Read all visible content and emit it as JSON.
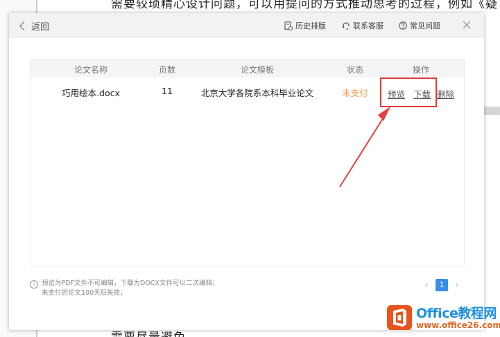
{
  "background": {
    "top_text": "需要较琐精心设计问题，可以用提问的方式推动思考的过程，例如《疑",
    "bottom_text": "需要尽量避免"
  },
  "dialog": {
    "back_label": "返回",
    "header_links": [
      {
        "label": "历史排版",
        "icon": "history-doc-icon"
      },
      {
        "label": "联系客服",
        "icon": "headset-icon"
      },
      {
        "label": "常见问题",
        "icon": "question-circle-icon"
      }
    ],
    "close_icon": "close-icon"
  },
  "table": {
    "columns": [
      "论文名称",
      "页数",
      "论文模板",
      "状态",
      "操作"
    ],
    "rows": [
      {
        "name": "巧用绘本.docx",
        "pages": "11",
        "template": "北京大学各院系本科毕业论文",
        "status": "未支付",
        "actions": [
          "预览",
          "下载",
          "删除"
        ]
      }
    ]
  },
  "footer": {
    "note_lines": [
      "预览为PDF文件不可编辑，下载为DOCX文件可以二次编辑；",
      "未支付的论文100天后失效；"
    ],
    "pager": {
      "current": "1"
    }
  },
  "watermark": {
    "title": "Office教程网",
    "url": "www.office26.com"
  },
  "colors": {
    "accent_blue": "#3a8ee6",
    "status_orange": "#f29b55",
    "highlight_red": "#e03a3a"
  }
}
